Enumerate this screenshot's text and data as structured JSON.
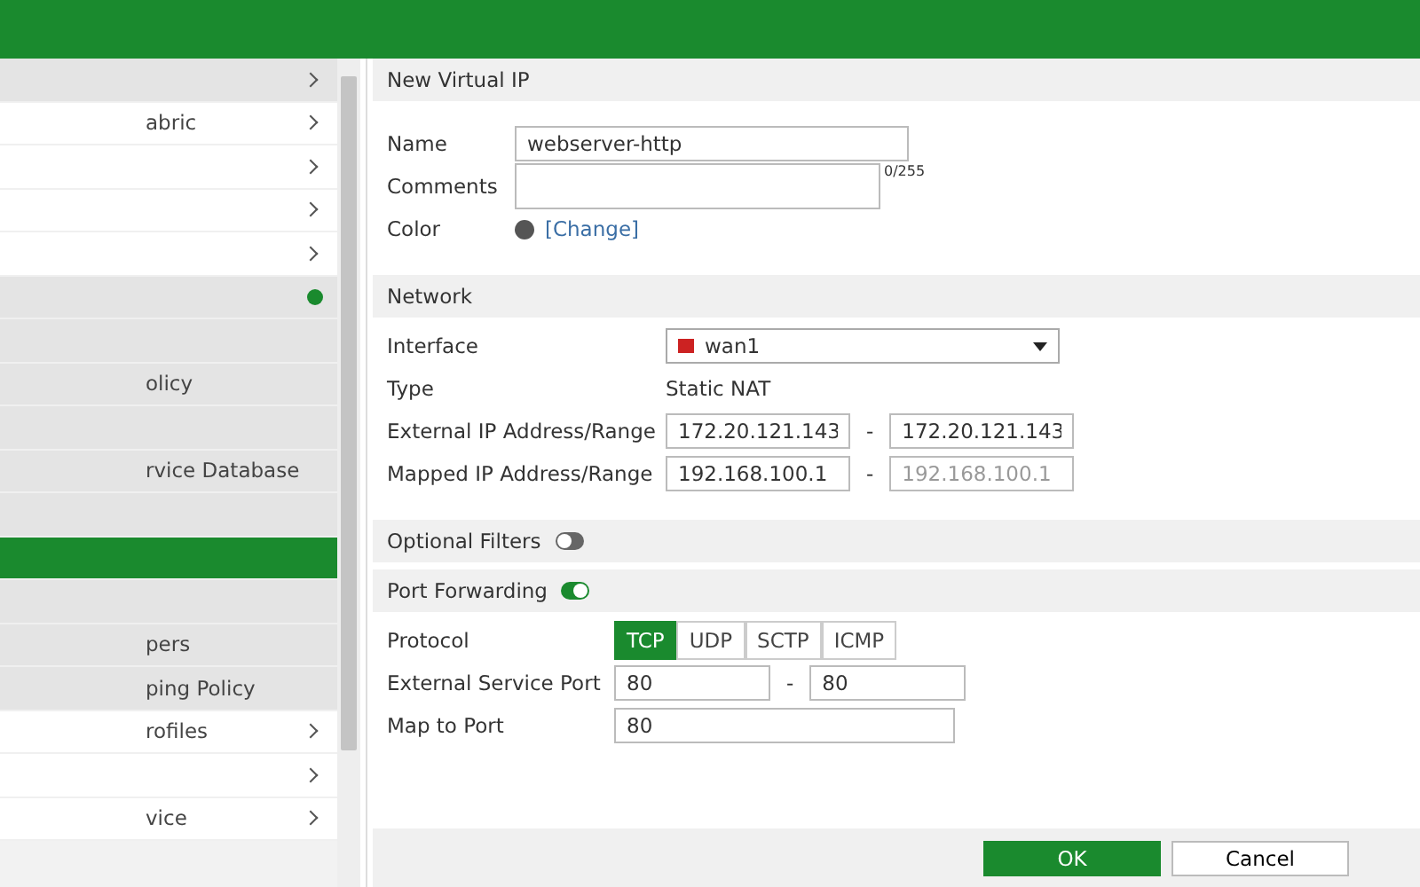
{
  "sidebar": {
    "items": [
      {
        "chevron": true,
        "selected": false,
        "shaded": true
      },
      {
        "label": "abric",
        "chevron": true,
        "selected": false,
        "shaded": false
      },
      {
        "chevron": true,
        "selected": false,
        "shaded": false
      },
      {
        "chevron": true,
        "selected": false,
        "shaded": false
      },
      {
        "chevron": true,
        "selected": false,
        "shaded": false
      },
      {
        "dot": true,
        "selected": false,
        "shaded": true
      },
      {
        "selected": false,
        "shaded": true
      },
      {
        "label": "olicy",
        "selected": false,
        "shaded": true
      },
      {
        "selected": false,
        "shaded": true
      },
      {
        "label": "rvice Database",
        "selected": false,
        "shaded": true
      },
      {
        "selected": false,
        "shaded": true
      },
      {
        "selected": true,
        "shaded": true
      },
      {
        "selected": false,
        "shaded": true
      },
      {
        "label": "pers",
        "selected": false,
        "shaded": true
      },
      {
        "label": "ping Policy",
        "selected": false,
        "shaded": true
      },
      {
        "label": "rofiles",
        "chevron": true,
        "selected": false,
        "shaded": false
      },
      {
        "chevron": true,
        "selected": false,
        "shaded": false
      },
      {
        "label": "vice",
        "chevron": true,
        "selected": false,
        "shaded": false
      }
    ]
  },
  "form": {
    "title": "New Virtual IP",
    "name": {
      "label": "Name",
      "value": "webserver-http"
    },
    "comments": {
      "label": "Comments",
      "counter": "0/255"
    },
    "color": {
      "label": "Color",
      "link": "[Change]"
    },
    "network": {
      "title": "Network",
      "interface": {
        "label": "Interface",
        "value": "wan1"
      },
      "type": {
        "label": "Type",
        "value": "Static NAT"
      },
      "external": {
        "label": "External IP Address/Range",
        "from": "172.20.121.143",
        "sep": "-",
        "to": "172.20.121.143"
      },
      "mapped": {
        "label": "Mapped IP Address/Range",
        "from": "192.168.100.1",
        "sep": "-",
        "to": "192.168.100.1"
      }
    },
    "optional_filters": {
      "label": "Optional Filters",
      "on": false
    },
    "port_forwarding": {
      "label": "Port Forwarding",
      "on": true,
      "protocol": {
        "label": "Protocol",
        "options": [
          {
            "label": "TCP",
            "selected": true
          },
          {
            "label": "UDP",
            "selected": false
          },
          {
            "label": "SCTP",
            "selected": false
          },
          {
            "label": "ICMP",
            "selected": false
          }
        ]
      },
      "external_port": {
        "label": "External Service Port",
        "from": "80",
        "sep": "-",
        "to": "80"
      },
      "map_port": {
        "label": "Map to Port",
        "value": "80"
      }
    }
  },
  "buttons": [
    {
      "label": "OK",
      "kind": "primary"
    },
    {
      "label": "Cancel",
      "kind": "secondary"
    }
  ]
}
